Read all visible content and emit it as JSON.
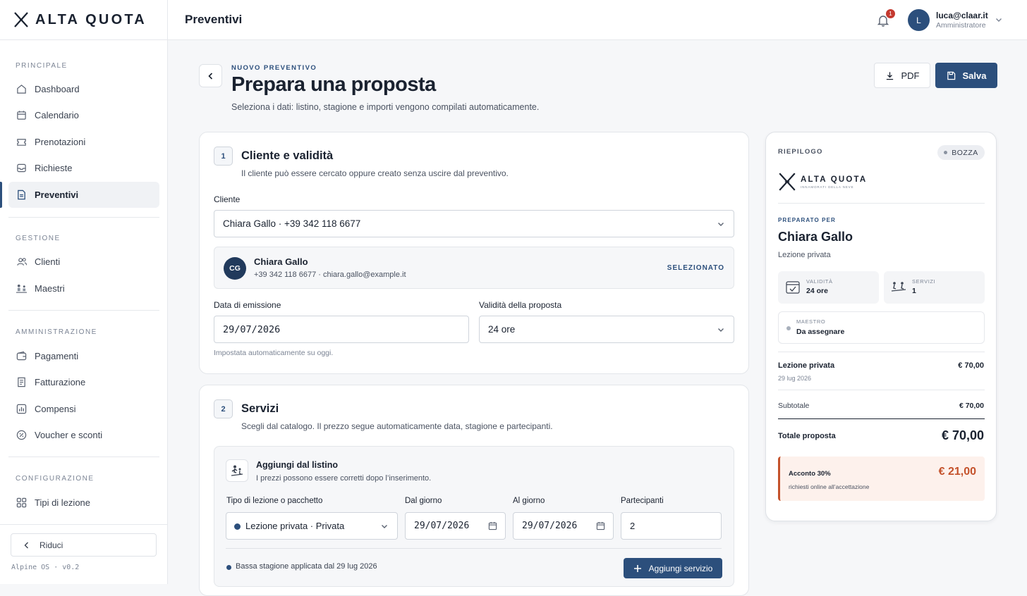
{
  "app": {
    "brand": "ALTA QUOTA",
    "brand_tagline": "INNAMORATI DELLA NEVE",
    "version": "Alpine OS · v0.2"
  },
  "topbar": {
    "title": "Preventivi",
    "notifications": "1",
    "user_initial": "L",
    "user_email": "luca@claar.it",
    "user_role": "Amministratore"
  },
  "sidebar": {
    "sections": [
      "PRINCIPALE",
      "GESTIONE",
      "AMMINISTRAZIONE",
      "CONFIGURAZIONE"
    ],
    "items": [
      {
        "label": "Dashboard",
        "icon": "home-icon"
      },
      {
        "label": "Calendario",
        "icon": "calendar-icon"
      },
      {
        "label": "Prenotazioni",
        "icon": "ticket-icon"
      },
      {
        "label": "Richieste",
        "icon": "inbox-icon"
      },
      {
        "label": "Preventivi",
        "icon": "document-icon",
        "active": true
      },
      {
        "label": "Clienti",
        "icon": "users-icon"
      },
      {
        "label": "Maestri",
        "icon": "instructor-icon"
      },
      {
        "label": "Pagamenti",
        "icon": "wallet-icon"
      },
      {
        "label": "Fatturazione",
        "icon": "invoice-icon"
      },
      {
        "label": "Compensi",
        "icon": "chart-icon"
      },
      {
        "label": "Voucher e sconti",
        "icon": "discount-icon"
      },
      {
        "label": "Tipi di lezione",
        "icon": "grid-icon"
      }
    ],
    "collapse_label": "Riduci"
  },
  "header": {
    "eyebrow": "NUOVO PREVENTIVO",
    "title": "Prepara una proposta",
    "subtitle": "Seleziona i dati: listino, stagione e importi vengono compilati automaticamente.",
    "pdf_label": "PDF",
    "save_label": "Salva"
  },
  "step1": {
    "num": "1",
    "title": "Cliente e validità",
    "desc": "Il cliente può essere cercato oppure creato senza uscire dal preventivo.",
    "client_label": "Cliente",
    "client_value": "Chiara Gallo · +39 342 118 6677",
    "selected": {
      "initials": "CG",
      "name": "Chiara Gallo",
      "contact": "+39 342 118 6677 · chiara.gallo@example.it",
      "badge": "SELEZIONATO"
    },
    "issue_label": "Data di emissione",
    "issue_value": "29/07/2026",
    "validity_label": "Validità della proposta",
    "validity_value": "24 ore",
    "hint": "Impostata automaticamente su oggi."
  },
  "step2": {
    "num": "2",
    "title": "Servizi",
    "desc": "Scegli dal catalogo. Il prezzo segue automaticamente data, stagione e partecipanti.",
    "listino_title": "Aggiungi dal listino",
    "listino_desc": "I prezzi possono essere corretti dopo l’inserimento.",
    "type_label": "Tipo di lezione o pacchetto",
    "type_value": "Lezione privata · Privata",
    "from_label": "Dal giorno",
    "from_value": "29/07/2026",
    "to_label": "Al giorno",
    "to_value": "29/07/2026",
    "participants_label": "Partecipanti",
    "participants_value": "2",
    "season_note": "Bassa stagione applicata dal 29 lug 2026",
    "add_label": "Aggiungi servizio"
  },
  "summary": {
    "tag": "RIEPILOGO",
    "status": "BOZZA",
    "prepared_for_label": "PREPARATO PER",
    "client_name": "Chiara Gallo",
    "service_type": "Lezione privata",
    "validity_label": "VALIDITÀ",
    "validity_value": "24 ore",
    "services_label": "SERVIZI",
    "services_value": "1",
    "maestro_label": "MAESTRO",
    "maestro_value": "Da assegnare",
    "line_name": "Lezione privata",
    "line_date": "29 lug 2026",
    "line_price": "€ 70,00",
    "subtotal_label": "Subtotale",
    "subtotal_value": "€ 70,00",
    "total_label": "Totale proposta",
    "total_value": "€ 70,00",
    "deposit_label": "Acconto 30%",
    "deposit_note": "richiesti online all’accettazione",
    "deposit_value": "€ 21,00"
  },
  "colors": {
    "accent": "#2c4f7c",
    "danger": "#c4392f",
    "deposit": "#c4522b"
  }
}
